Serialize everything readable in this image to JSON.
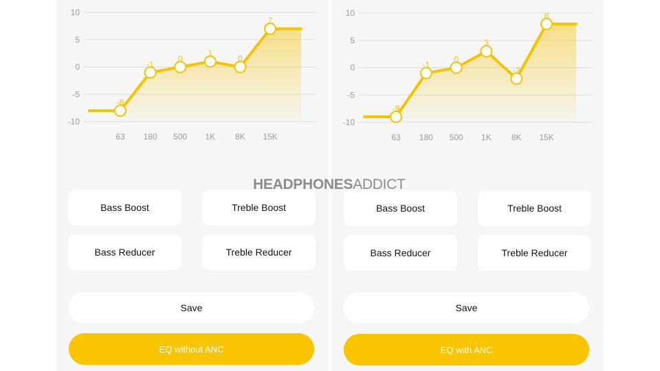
{
  "watermark": {
    "bold": "HEADPHONES",
    "light": "ADDICT"
  },
  "colors": {
    "accent": "#f5c400",
    "panel_bg": "#f6f6f6",
    "grid": "#dddddd",
    "tick": "#9a9a9a"
  },
  "panels": [
    {
      "presets": {
        "bass_boost": "Bass Boost",
        "treble_boost": "Treble Boost",
        "bass_reducer": "Bass Reducer",
        "treble_reducer": "Treble Reducer"
      },
      "save_label": "Save",
      "eq_button_label": "EQ without ANC"
    },
    {
      "presets": {
        "bass_boost": "Bass Boost",
        "treble_boost": "Treble Boost",
        "bass_reducer": "Bass Reducer",
        "treble_reducer": "Treble Reducer"
      },
      "save_label": "Save",
      "eq_button_label": "EQ with ANC"
    }
  ],
  "chart_data": [
    {
      "type": "area",
      "categories": [
        "63",
        "180",
        "500",
        "1K",
        "8K",
        "15K"
      ],
      "values": [
        -8,
        -1,
        0,
        1,
        0,
        7
      ],
      "value_labels": [
        "-8",
        "-1",
        "0",
        "1",
        "0",
        "7"
      ],
      "ylim": [
        -10,
        10
      ],
      "yticks": [
        "10",
        "5",
        "0",
        "-5",
        "-10"
      ],
      "grid": true
    },
    {
      "type": "area",
      "categories": [
        "63",
        "180",
        "500",
        "1K",
        "8K",
        "15K"
      ],
      "values": [
        -9,
        -1,
        0,
        3,
        -2,
        8
      ],
      "value_labels": [
        "-9",
        "-1",
        "0",
        "3",
        "-2",
        "8"
      ],
      "ylim": [
        -10,
        10
      ],
      "yticks": [
        "10",
        "5",
        "0",
        "-5",
        "-10"
      ],
      "grid": true
    }
  ]
}
